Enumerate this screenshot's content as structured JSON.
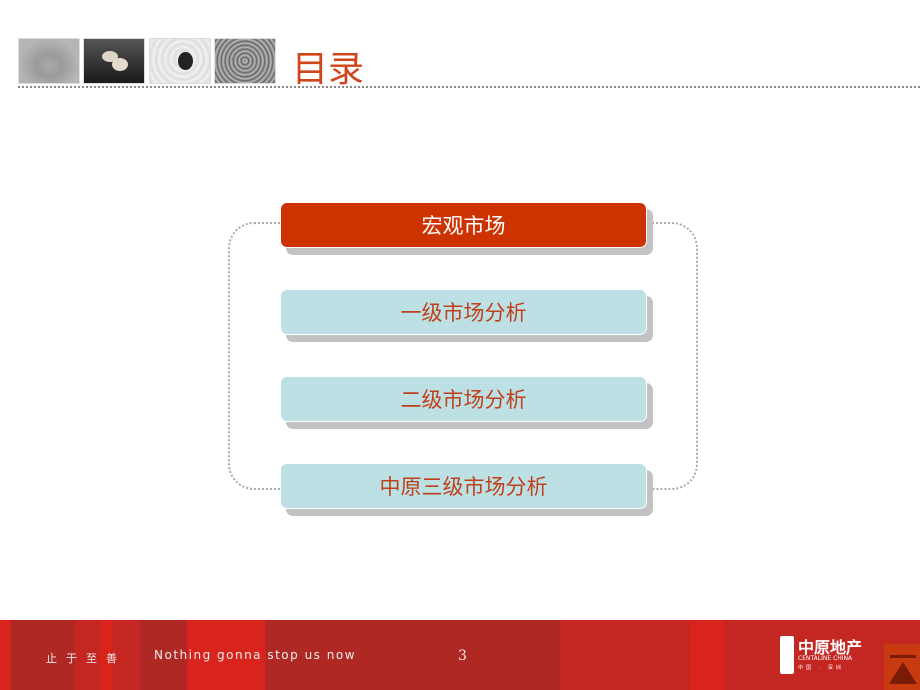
{
  "header": {
    "title": "目录",
    "images": [
      "sand-cone",
      "pebbles",
      "stone-ripples",
      "wood-rings"
    ]
  },
  "menu": {
    "items": [
      {
        "label": "宏观市场",
        "active": true
      },
      {
        "label": "一级市场分析",
        "active": false
      },
      {
        "label": "二级市场分析",
        "active": false
      },
      {
        "label": "中原三级市场分析",
        "active": false
      }
    ]
  },
  "footer": {
    "slogan_cn": "止于至善",
    "slogan_en": "Nothing gonna stop us now",
    "page_number": "3",
    "logo": {
      "cn": "中原地产",
      "en": "CENTALINE CHINA",
      "sub": "中国 · 深圳"
    }
  },
  "colors": {
    "accent": "#cc3300",
    "item_bg": "#bce0e3",
    "footer": "#b02824"
  }
}
